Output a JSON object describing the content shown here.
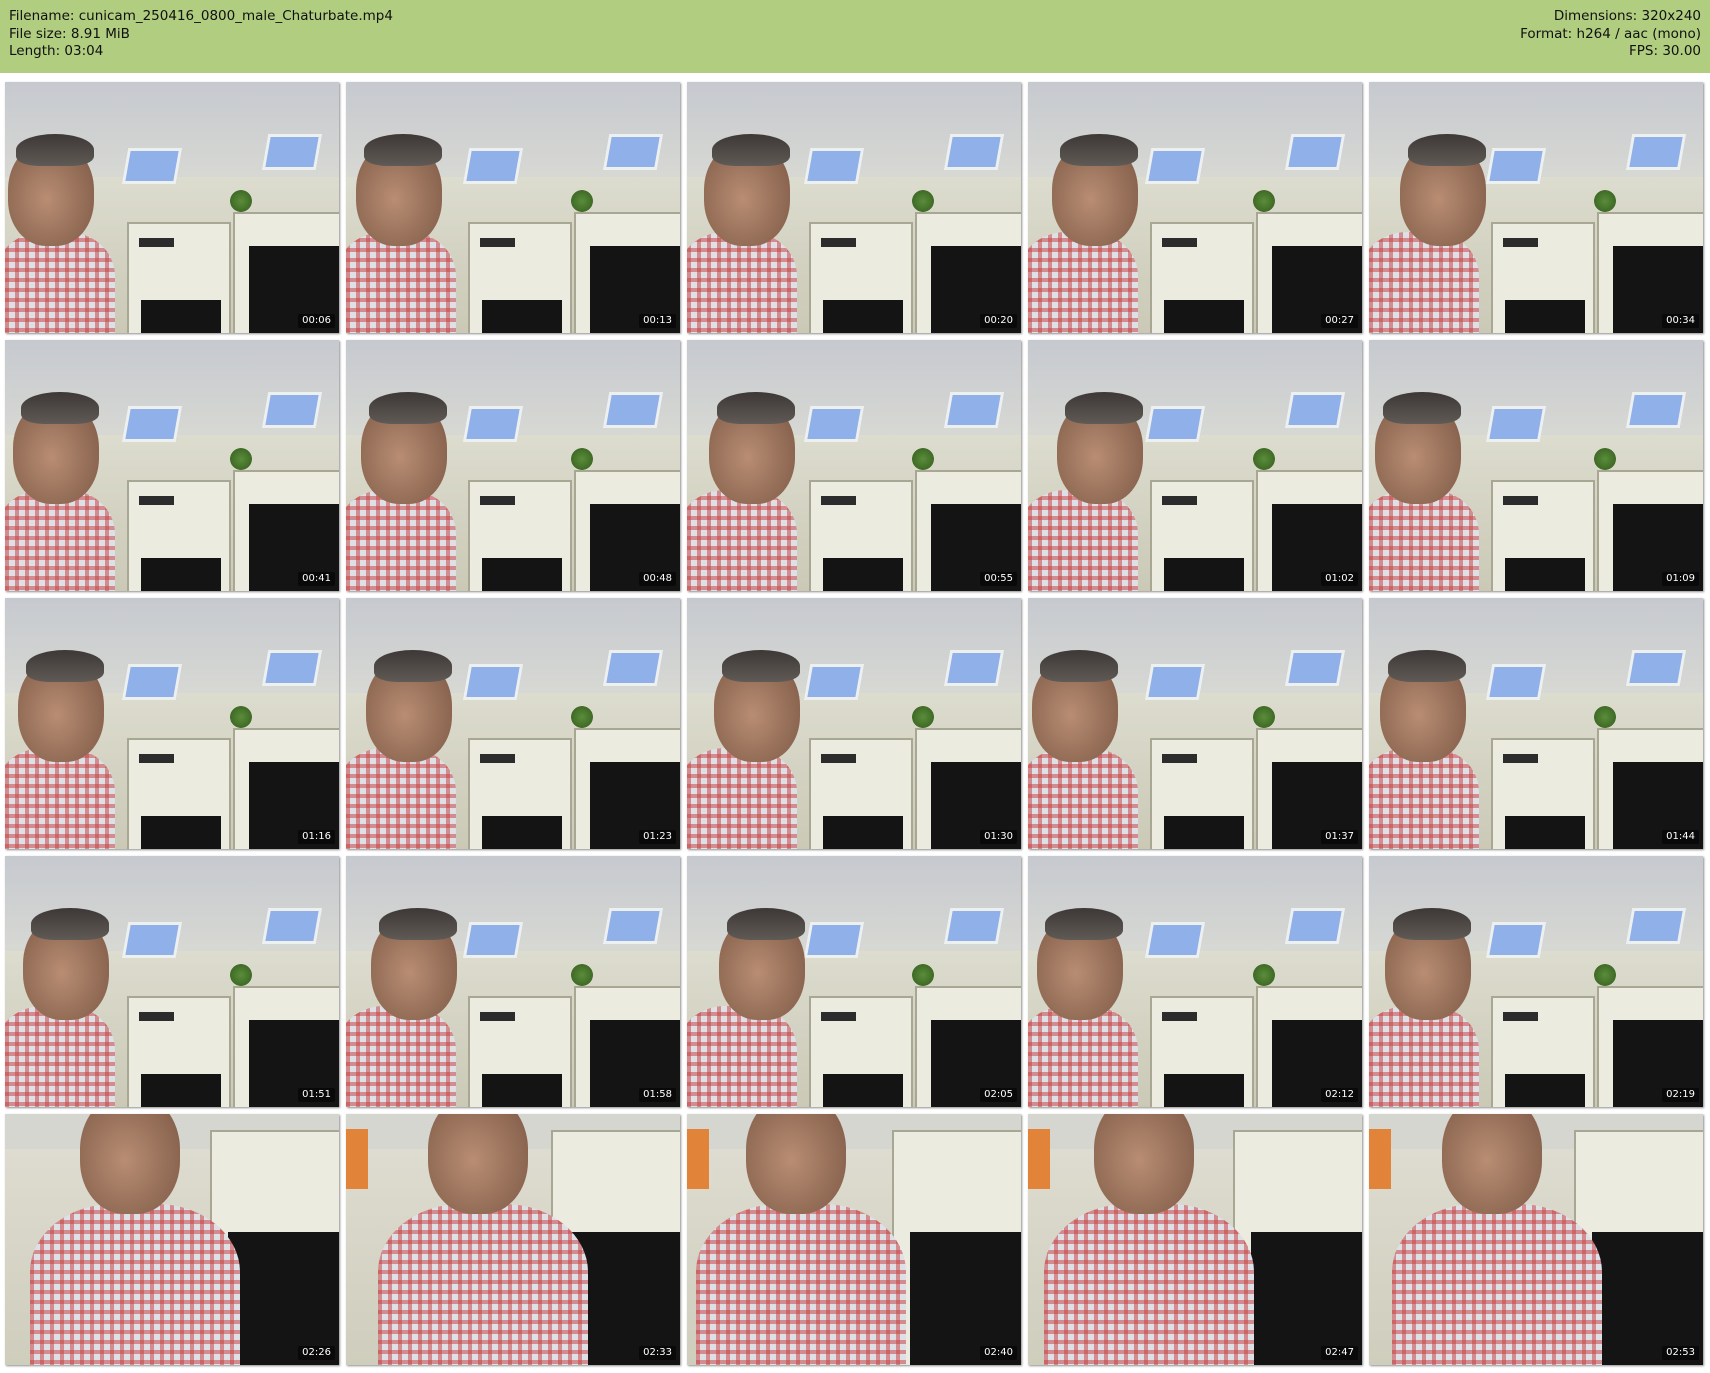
{
  "header": {
    "filename": "Filename: cunicam_250416_0800_male_Chaturbate.mp4",
    "file_size": "File size: 8.91 MiB",
    "length": "Length: 03:04",
    "dimensions": "Dimensions: 320x240",
    "format": "Format: h264 / aac (mono)",
    "fps": "FPS: 30.00",
    "background_color": "#b0cd80"
  },
  "thumbnails": [
    {
      "time": "00:06"
    },
    {
      "time": "00:13"
    },
    {
      "time": "00:20"
    },
    {
      "time": "00:27"
    },
    {
      "time": "00:34"
    },
    {
      "time": "00:41"
    },
    {
      "time": "00:48"
    },
    {
      "time": "00:55"
    },
    {
      "time": "01:02"
    },
    {
      "time": "01:09"
    },
    {
      "time": "01:16"
    },
    {
      "time": "01:23"
    },
    {
      "time": "01:30"
    },
    {
      "time": "01:37"
    },
    {
      "time": "01:44"
    },
    {
      "time": "01:51"
    },
    {
      "time": "01:58"
    },
    {
      "time": "02:05"
    },
    {
      "time": "02:12"
    },
    {
      "time": "02:19"
    },
    {
      "time": "02:26"
    },
    {
      "time": "02:33"
    },
    {
      "time": "02:40"
    },
    {
      "time": "02:47"
    },
    {
      "time": "02:53"
    }
  ]
}
